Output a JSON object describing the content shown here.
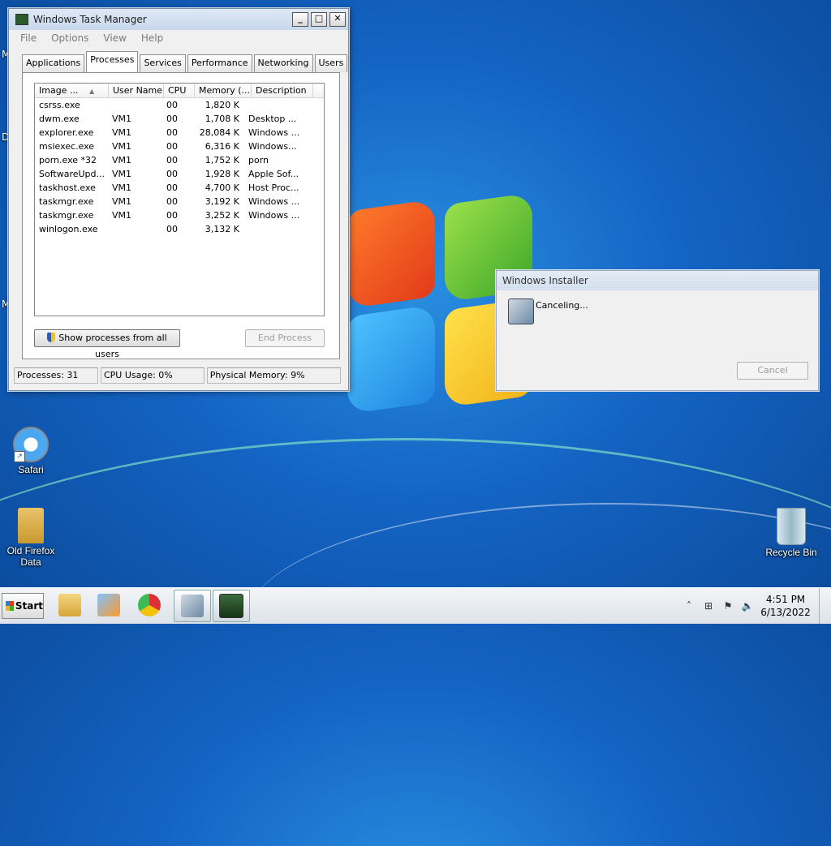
{
  "task_manager": {
    "title": "Windows Task Manager",
    "menu": [
      "File",
      "Options",
      "View",
      "Help"
    ],
    "tabs": [
      "Applications",
      "Processes",
      "Services",
      "Performance",
      "Networking",
      "Users"
    ],
    "active_tab": "Processes",
    "columns": [
      "Image ...",
      "User Name",
      "CPU",
      "Memory (...",
      "Description"
    ],
    "sort_indicator": "▲",
    "processes": [
      {
        "image": "csrss.exe",
        "user": "",
        "cpu": "00",
        "memory": "1,820 K",
        "description": ""
      },
      {
        "image": "dwm.exe",
        "user": "VM1",
        "cpu": "00",
        "memory": "1,708 K",
        "description": "Desktop ..."
      },
      {
        "image": "explorer.exe",
        "user": "VM1",
        "cpu": "00",
        "memory": "28,084 K",
        "description": "Windows ..."
      },
      {
        "image": "msiexec.exe",
        "user": "VM1",
        "cpu": "00",
        "memory": "6,316 K",
        "description": "Windows..."
      },
      {
        "image": "porn.exe *32",
        "user": "VM1",
        "cpu": "00",
        "memory": "1,752 K",
        "description": "porn"
      },
      {
        "image": "SoftwareUpd...",
        "user": "VM1",
        "cpu": "00",
        "memory": "1,928 K",
        "description": "Apple Sof..."
      },
      {
        "image": "taskhost.exe",
        "user": "VM1",
        "cpu": "00",
        "memory": "4,700 K",
        "description": "Host Proc..."
      },
      {
        "image": "taskmgr.exe",
        "user": "VM1",
        "cpu": "00",
        "memory": "3,192 K",
        "description": "Windows ..."
      },
      {
        "image": "taskmgr.exe",
        "user": "VM1",
        "cpu": "00",
        "memory": "3,252 K",
        "description": "Windows ..."
      },
      {
        "image": "winlogon.exe",
        "user": "",
        "cpu": "00",
        "memory": "3,132 K",
        "description": ""
      }
    ],
    "show_all_label": "Show processes from all users",
    "end_process_label": "End Process",
    "status": {
      "processes": "Processes: 31",
      "cpu": "CPU Usage: 0%",
      "memory": "Physical Memory: 9%"
    }
  },
  "installer": {
    "title": "Windows Installer",
    "message": "Canceling...",
    "cancel_label": "Cancel"
  },
  "desktop_icons": {
    "safari": "Safari",
    "firefox_line1": "Old Firefox",
    "firefox_line2": "Data",
    "recycle": "Recycle Bin"
  },
  "taskbar": {
    "start_label": "Start",
    "time": "4:51 PM",
    "date": "6/13/2022"
  }
}
